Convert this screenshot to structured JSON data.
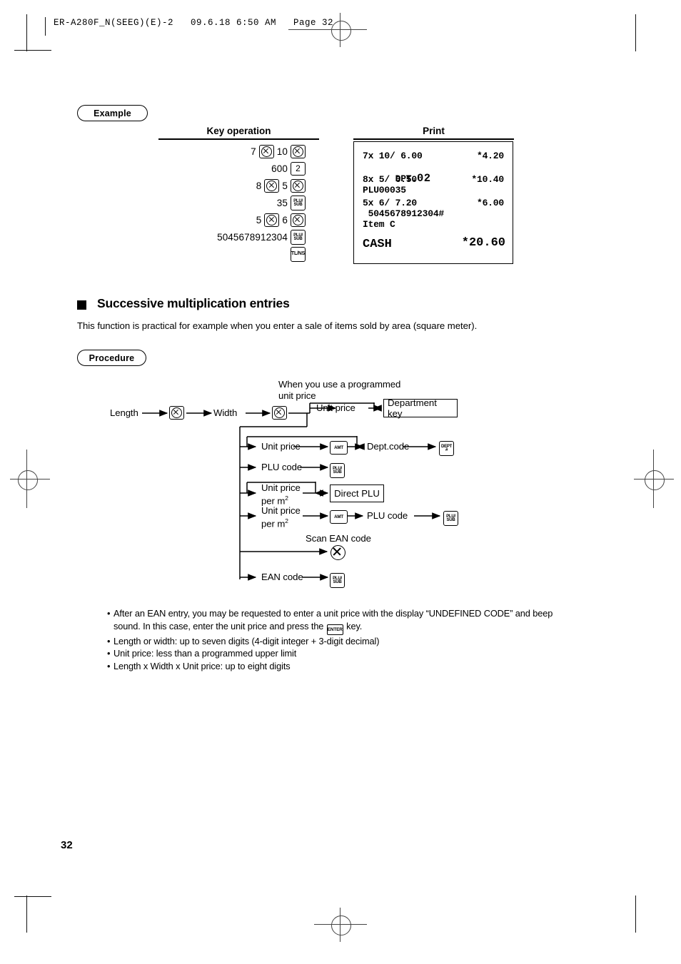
{
  "header": {
    "file_line": "ER-A280F_N(SEEG)(E)-2   09.6.18 6:50 AM   Page 32"
  },
  "example": {
    "badge": "Example",
    "col_key_operation": "Key operation",
    "col_print": "Print",
    "key_rows": [
      {
        "cells": [
          {
            "t": "num",
            "v": "7"
          },
          {
            "t": "key",
            "v": "multiply"
          },
          {
            "t": "num",
            "v": "10"
          },
          {
            "t": "key",
            "v": "multiply"
          }
        ]
      },
      {
        "cells": [
          {
            "t": "num",
            "v": "600"
          },
          {
            "t": "key",
            "v": "2"
          }
        ]
      },
      {
        "cells": [
          {
            "t": "num",
            "v": "8"
          },
          {
            "t": "key",
            "v": "multiply"
          },
          {
            "t": "num",
            "v": "5"
          },
          {
            "t": "key",
            "v": "multiply"
          }
        ]
      },
      {
        "cells": [
          {
            "t": "num",
            "v": "35"
          },
          {
            "t": "key",
            "v": "PLU/SUB"
          }
        ]
      },
      {
        "cells": [
          {
            "t": "num",
            "v": "5"
          },
          {
            "t": "key",
            "v": "multiply"
          },
          {
            "t": "num",
            "v": "6"
          },
          {
            "t": "key",
            "v": "multiply"
          }
        ]
      },
      {
        "cells": [
          {
            "t": "num",
            "v": "5045678912304"
          },
          {
            "t": "key",
            "v": "PLU/SUB"
          }
        ]
      },
      {
        "cells": [
          {
            "t": "key",
            "v": "TL/NS"
          }
        ]
      }
    ],
    "receipt": {
      "line1_left": "7x 10/ 6.00",
      "line1_right": "*4.20",
      "line2_prefix": "DPT.",
      "line2_value": "02",
      "line3_left": "8x 5/ 6.50",
      "line3_right": "*10.40",
      "line4": "PLU00035",
      "line5_left": "5x 6/ 7.20",
      "line5_right": "*6.00",
      "line6": " 5045678912304#",
      "line7": "Item C",
      "total_label": "CASH",
      "total_value": "*20.60"
    }
  },
  "section": {
    "heading": "Successive multiplication entries",
    "intro": "This function is practical for example when you enter a sale of items sold by area (square meter).",
    "procedure_badge": "Procedure"
  },
  "flow": {
    "note_programmed_line1": "When you use a programmed",
    "note_programmed_line2": "unit price",
    "length": "Length",
    "width": "Width",
    "multiply_key": "multiply",
    "row1_unit_price": "Unit price",
    "row1_dest": "Department key",
    "row2_unit_price": "Unit price",
    "row2_key_amt": "AMT",
    "row2_dept_code": "Dept.code",
    "row2_key_dept_top": "DEPT",
    "row2_key_dept_bottom": "#",
    "row3_plu_code": "PLU code",
    "row3_key": "PLU/SUB",
    "row4_unit_price_l1": "Unit price",
    "row4_unit_price_l2": "per m",
    "row4_unit_price_sup": "2",
    "row4_dest": "Direct PLU",
    "row5_unit_price_l1": "Unit price",
    "row5_unit_price_l2": "per m",
    "row5_unit_price_sup": "2",
    "row5_key_amt": "AMT",
    "row5_plu_code": "PLU code",
    "row5_key_plu": "PLU/SUB",
    "row6_scan_label": "Scan EAN code",
    "row7_ean_code": "EAN code",
    "row7_key": "PLU/SUB"
  },
  "notes": [
    {
      "bullet": "•",
      "part1": "After an EAN entry, you may be requested to enter a unit price with the display “UNDEFINED CODE” and beep sound. In this case, enter the unit price and press the ",
      "key": "ENTER",
      "part2": " key."
    },
    {
      "bullet": "•",
      "part1": "Length or width: up to seven digits (4-digit integer + 3-digit decimal)",
      "key": "",
      "part2": ""
    },
    {
      "bullet": "•",
      "part1": "Unit price: less than a programmed upper limit",
      "key": "",
      "part2": ""
    },
    {
      "bullet": "•",
      "part1": "Length x Width x Unit price: up to eight digits",
      "key": "",
      "part2": ""
    }
  ],
  "footer": {
    "page_number": "32"
  },
  "colors": {
    "ink": "#000000",
    "paper": "#ffffff",
    "regmark": "#444444"
  }
}
